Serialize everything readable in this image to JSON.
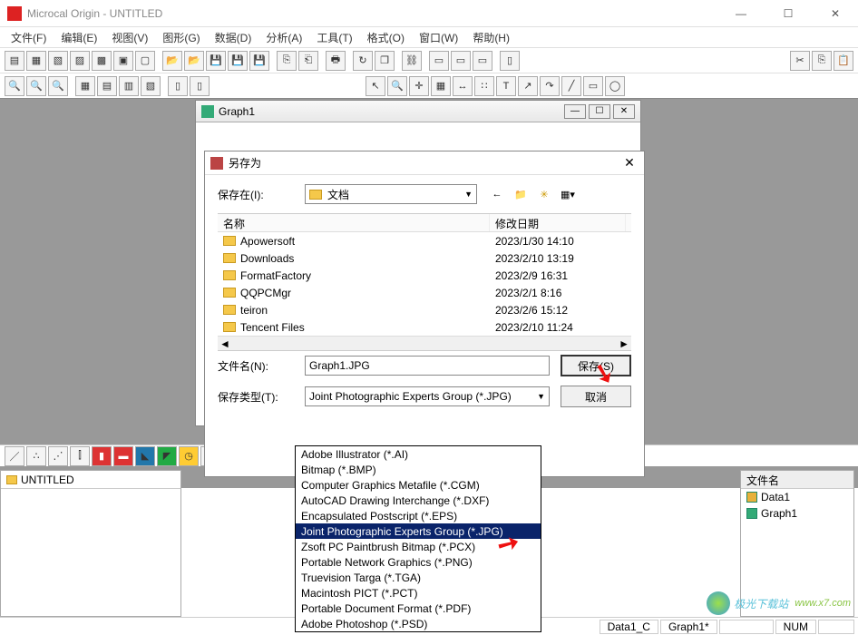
{
  "app": {
    "title": "Microcal Origin - UNTITLED"
  },
  "menu": {
    "items": [
      "文件(F)",
      "编辑(E)",
      "视图(V)",
      "图形(G)",
      "数据(D)",
      "分析(A)",
      "工具(T)",
      "格式(O)",
      "窗口(W)",
      "帮助(H)"
    ]
  },
  "graph_window": {
    "title": "Graph1"
  },
  "saveas": {
    "title": "另存为",
    "location_label": "保存在(I):",
    "location_value": "文档",
    "name_col": "名称",
    "date_col": "修改日期",
    "files": [
      {
        "name": "Apowersoft",
        "date": "2023/1/30 14:10"
      },
      {
        "name": "Downloads",
        "date": "2023/2/10 13:19"
      },
      {
        "name": "FormatFactory",
        "date": "2023/2/9 16:31"
      },
      {
        "name": "QQPCMgr",
        "date": "2023/2/1 8:16"
      },
      {
        "name": "teiron",
        "date": "2023/2/6 15:12"
      },
      {
        "name": "Tencent Files",
        "date": "2023/2/10 11:24"
      }
    ],
    "filename_label": "文件名(N):",
    "filename_value": "Graph1.JPG",
    "type_label": "保存类型(T):",
    "type_value": "Joint Photographic Experts Group (*.JPG)",
    "save_btn": "保存(S)",
    "cancel_btn": "取消"
  },
  "type_options": [
    "Adobe Illustrator (*.AI)",
    "Bitmap (*.BMP)",
    "Computer Graphics Metafile (*.CGM)",
    "AutoCAD Drawing Interchange (*.DXF)",
    "Encapsulated Postscript (*.EPS)",
    "Joint Photographic Experts Group (*.JPG)",
    "Zsoft PC Paintbrush Bitmap (*.PCX)",
    "Portable Network Graphics (*.PNG)",
    "Truevision Targa (*.TGA)",
    "Macintosh PICT (*.PCT)",
    "Portable Document Format (*.PDF)",
    "Adobe Photoshop (*.PSD)"
  ],
  "selected_type_index": 5,
  "left_panel": {
    "tab": "UNTITLED"
  },
  "right_panel": {
    "header": "文件名",
    "items": [
      {
        "name": "Data1"
      },
      {
        "name": "Graph1"
      }
    ]
  },
  "status": {
    "cells": [
      "Data1_C",
      "Graph1*",
      "NUM"
    ]
  },
  "watermark": "极光下载站"
}
